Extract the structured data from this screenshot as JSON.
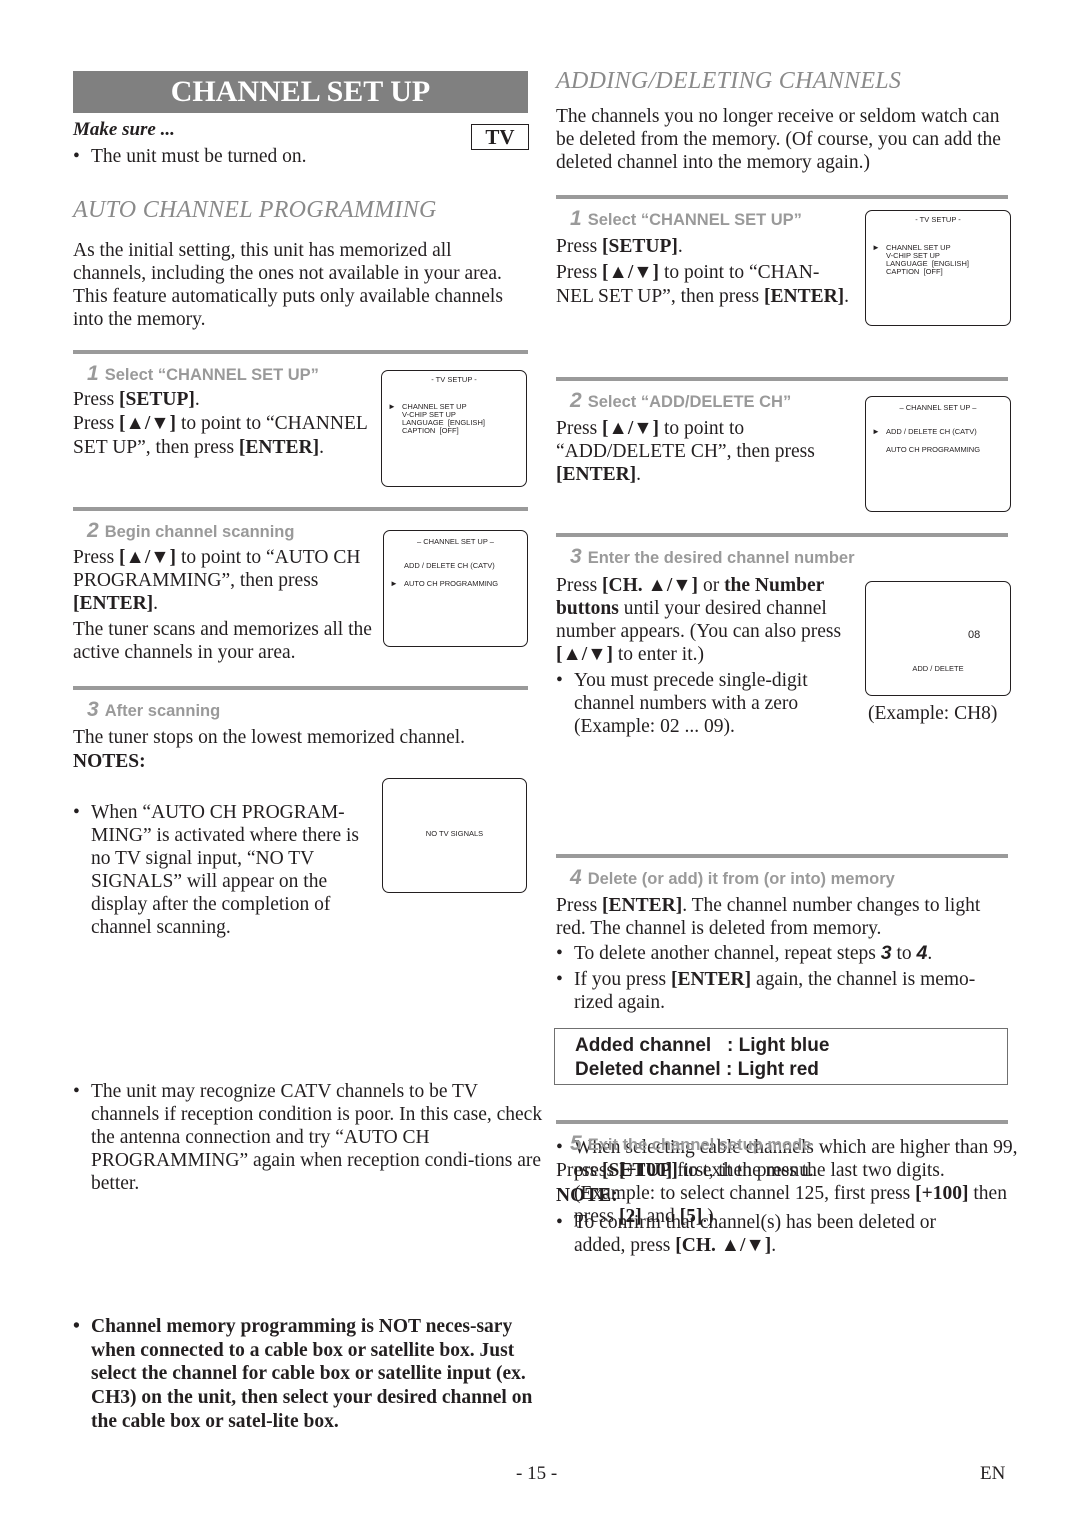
{
  "page": {
    "title": "CHANNEL SET UP",
    "make_sure_label": "Make sure ...",
    "make_sure_item": "The unit must be turned on.",
    "tv_badge": "TV",
    "page_number": "- 15 -",
    "language_code": "EN"
  },
  "auto": {
    "title": "AUTO CHANNEL PROGRAMMING",
    "intro": "As the initial setting, this unit has memorized all channels, including the ones not available in your area. This feature automatically puts only available channels into the memory.",
    "steps": [
      {
        "num": "1",
        "title": "Select “CHANNEL SET UP”",
        "lines": [
          "Press ",
          "[SETUP]",
          ".",
          "Press ",
          "[▲/▼]",
          " to point to “CHANNEL SET UP”, then press ",
          "[ENTER]",
          "."
        ],
        "screen": {
          "title": "- TV SETUP -",
          "items": [
            "CHANNEL SET UP",
            "V-CHIP SET UP",
            "LANGUAGE  [ENGLISH]",
            "CAPTION  [OFF]"
          ],
          "selected_index": 0
        }
      },
      {
        "num": "2",
        "title": "Begin channel scanning",
        "press": "Press ",
        "keys": "[▲/▼]",
        "text_a": " to point to “AUTO CH PROGRAMMING”, then press ",
        "enter": "[ENTER]",
        "dot": ".",
        "after": "The tuner scans and memorizes all the active channels in your area.",
        "screen": {
          "title": "– CHANNEL SET UP –",
          "items": [
            "ADD / DELETE CH (CATV)",
            "AUTO CH PROGRAMMING"
          ],
          "selected_index": 1
        }
      },
      {
        "num": "3",
        "title": "After scanning",
        "text": "The tuner stops on the lowest memorized channel.",
        "notes_label": "NOTES:",
        "note1": "When “AUTO CH PROGRAM-MING” is activated where there is no TV signal input, “NO TV SIGNALS” will appear on the display after the completion of channel scanning.",
        "note2": "The unit may recognize CATV channels to be TV channels if reception condition is poor. In this case, check the antenna connection and try “AUTO CH PROGRAMMING” again when reception condi-tions are better.",
        "note3": "Channel memory programming is NOT neces-sary when connected to a cable box or satellite box. Just select the channel for cable box or satellite input (ex. CH3) on the unit, then select your desired channel on the cable box or satel-lite box.",
        "screen": {
          "message": "NO  TV  SIGNALS"
        }
      }
    ]
  },
  "adding": {
    "title": "ADDING/DELETING CHANNELS",
    "intro": "The channels you no longer receive or seldom watch can be deleted from the memory. (Of course, you can add the deleted channel into the memory again.)",
    "steps": [
      {
        "num": "1",
        "title": "Select “CHANNEL SET UP”",
        "press": "Press ",
        "setup": "[SETUP]",
        "dot": ".",
        "keys": "[▲/▼]",
        "text_a": " to point to “CHAN-NEL SET UP”, then press ",
        "enter": "[ENTER]",
        "screen": {
          "title": "- TV SETUP -",
          "items": [
            "CHANNEL SET UP",
            "V-CHIP SET UP",
            "LANGUAGE  [ENGLISH]",
            "CAPTION  [OFF]"
          ],
          "selected_index": 0
        }
      },
      {
        "num": "2",
        "title": "Select “ADD/DELETE CH”",
        "press": "Press ",
        "keys": "[▲/▼]",
        "text_a": " to point to “ADD/DELETE CH”, then press ",
        "enter": "[ENTER]",
        "dot": ".",
        "screen": {
          "title": "– CHANNEL SET UP –",
          "items": [
            "ADD / DELETE CH (CATV)",
            "AUTO CH PROGRAMMING"
          ],
          "selected_index": 0
        }
      },
      {
        "num": "3",
        "title": "Enter the desired channel number",
        "press": "Press ",
        "ch_keys": "[CH. ▲/▼]",
        "or": " or ",
        "number_buttons": "the Number buttons",
        "text_a": " until your desired channel number appears. (You can also press ",
        "keys": "[▲/▼]",
        "text_b": " to enter it.)",
        "bullet1": "You must precede single-digit channel numbers with a zero (Example: 02 ...  09).",
        "bullet2_a": "When selecting cable channels which are higher than 99, press ",
        "bullet2_key1": "[+100]",
        "bullet2_b": " first, then press the last two digits. (Example: to select channel 125, first press ",
        "bullet2_key2": "[+100]",
        "bullet2_c": " then press ",
        "bullet2_key3": "[2]",
        "bullet2_d": " and ",
        "bullet2_key4": "[5]",
        "bullet2_e": ".)",
        "screen": {
          "channel": "08",
          "label": "ADD / DELETE",
          "caption": "(Example: CH8)"
        }
      },
      {
        "num": "4",
        "title": "Delete (or add) it from (or into) memory",
        "press": "Press ",
        "enter": "[ENTER]",
        "text_a": ". The channel number changes to light red. The channel is deleted from memory.",
        "bullet1_a": "To delete another channel, repeat steps ",
        "bullet1_s1": "3",
        "bullet1_to": " to ",
        "bullet1_s2": "4",
        "bullet1_end": ".",
        "bullet2_a": "If you press ",
        "bullet2_key": "[ENTER]",
        "bullet2_b": " again, the channel is memo-rized again.",
        "legend": {
          "added_label": "Added channel   : ",
          "added_value": "Light blue",
          "deleted_label": "Deleted channel : ",
          "deleted_value": "Light red"
        }
      },
      {
        "num": "5",
        "title": "Exit the channel setup mode",
        "press": "Press ",
        "setup": "[SETUP]",
        "text_a": " to exit the menu.",
        "note_label": "NOTE:",
        "note_a": "To confirm that channel(s) has been deleted or added, press ",
        "note_key": "[CH. ▲/▼]",
        "note_end": "."
      }
    ]
  }
}
